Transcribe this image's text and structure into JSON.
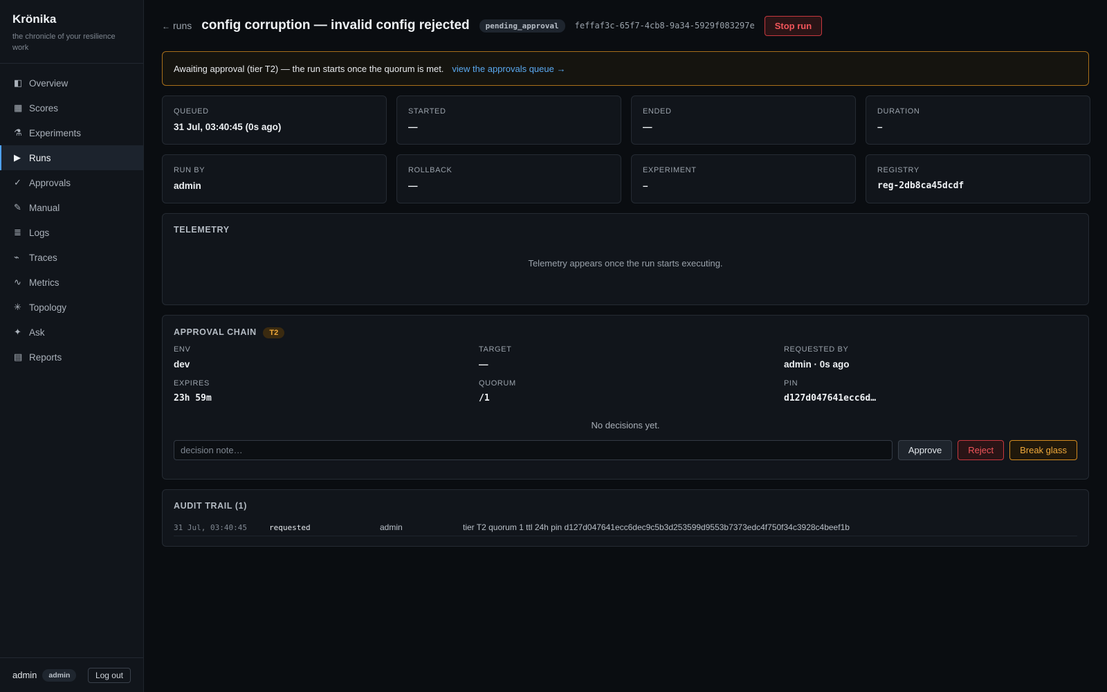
{
  "app": {
    "name": "Krönika",
    "tagline": "the chronicle of your resilience work"
  },
  "sidebar": {
    "items": [
      {
        "label": "Overview",
        "icon": "overview-icon",
        "glyph": "◧"
      },
      {
        "label": "Scores",
        "icon": "scores-icon",
        "glyph": "▦"
      },
      {
        "label": "Experiments",
        "icon": "flask-icon",
        "glyph": "⚗"
      },
      {
        "label": "Runs",
        "icon": "play-icon",
        "glyph": "▶",
        "active": true
      },
      {
        "label": "Approvals",
        "icon": "check-icon",
        "glyph": "✓"
      },
      {
        "label": "Manual",
        "icon": "pencil-icon",
        "glyph": "✎"
      },
      {
        "label": "Logs",
        "icon": "logs-icon",
        "glyph": "≣"
      },
      {
        "label": "Traces",
        "icon": "traces-icon",
        "glyph": "⌁"
      },
      {
        "label": "Metrics",
        "icon": "metrics-icon",
        "glyph": "∿"
      },
      {
        "label": "Topology",
        "icon": "topology-icon",
        "glyph": "✳"
      },
      {
        "label": "Ask",
        "icon": "sparkle-icon",
        "glyph": "✦"
      },
      {
        "label": "Reports",
        "icon": "reports-icon",
        "glyph": "▤"
      }
    ],
    "footer": {
      "user": "admin",
      "role": "admin",
      "logout_label": "Log out"
    }
  },
  "header": {
    "back_arrow": "←",
    "back_label": "runs",
    "title": "config corruption — invalid config rejected",
    "status": "pending_approval",
    "run_id": "feffaf3c-65f7-4cb8-9a34-5929f083297e",
    "stop_label": "Stop run"
  },
  "alert": {
    "message": "Awaiting approval (tier T2) — the run starts once the quorum is met.",
    "link_label": "view the approvals queue →"
  },
  "cards_row1": [
    {
      "label": "QUEUED",
      "value": "31 Jul, 03:40:45 (0s ago)"
    },
    {
      "label": "STARTED",
      "value": "—"
    },
    {
      "label": "ENDED",
      "value": "—"
    },
    {
      "label": "DURATION",
      "value": "–"
    }
  ],
  "cards_row2": [
    {
      "label": "RUN BY",
      "value": "admin"
    },
    {
      "label": "ROLLBACK",
      "value": "—"
    },
    {
      "label": "EXPERIMENT",
      "value": "–"
    },
    {
      "label": "REGISTRY",
      "value": "reg-2db8ca45dcdf"
    }
  ],
  "telemetry": {
    "title": "TELEMETRY",
    "message": "Telemetry appears once the run starts executing."
  },
  "approval": {
    "title": "APPROVAL CHAIN",
    "tier": "T2",
    "fields": [
      {
        "label": "ENV",
        "value": "dev"
      },
      {
        "label": "TARGET",
        "value": "—"
      },
      {
        "label": "REQUESTED BY",
        "value": "admin · 0s ago"
      },
      {
        "label": "EXPIRES",
        "value": "23h 59m"
      },
      {
        "label": "QUORUM",
        "value": "/1"
      },
      {
        "label": "PIN",
        "value": "d127d047641ecc6d…"
      }
    ],
    "empty_message": "No decisions yet.",
    "note_placeholder": "decision note…",
    "approve_label": "Approve",
    "reject_label": "Reject",
    "break_glass_label": "Break glass"
  },
  "audit": {
    "title": "AUDIT TRAIL (1)",
    "rows": [
      {
        "time": "31 Jul, 03:40:45",
        "action": "requested",
        "actor": "admin",
        "detail": "tier T2 quorum 1 ttl 24h pin d127d047641ecc6dec9c5b3d253599d9553b7373edc4f750f34c3928c4beef1b"
      }
    ]
  }
}
